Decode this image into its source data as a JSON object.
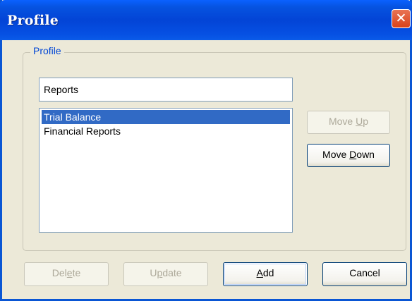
{
  "window": {
    "title": "Profile"
  },
  "group": {
    "label": "Profile"
  },
  "name_input": {
    "value": "Reports"
  },
  "list": {
    "items": [
      {
        "label": "Trial Balance",
        "selected": true
      },
      {
        "label": "Financial Reports",
        "selected": false
      }
    ]
  },
  "buttons": {
    "move_up": {
      "pre": "Move ",
      "mnemonic": "U",
      "post": "p",
      "enabled": false
    },
    "move_down": {
      "pre": "Move ",
      "mnemonic": "D",
      "post": "own",
      "enabled": true
    },
    "delete": {
      "pre": "Del",
      "mnemonic": "e",
      "post": "te",
      "enabled": false
    },
    "update": {
      "pre": "U",
      "mnemonic": "p",
      "post": "date",
      "enabled": false
    },
    "add": {
      "pre": "",
      "mnemonic": "A",
      "post": "dd",
      "enabled": true
    },
    "cancel": {
      "pre": "Cancel",
      "mnemonic": "",
      "post": "",
      "enabled": true
    }
  },
  "colors": {
    "titlebar": "#0344D6",
    "close": "#D9421A",
    "selection": "#316AC5",
    "group_label": "#0046D5",
    "dialog_bg": "#ECE9D8"
  },
  "icons": {
    "close": "close-icon"
  }
}
